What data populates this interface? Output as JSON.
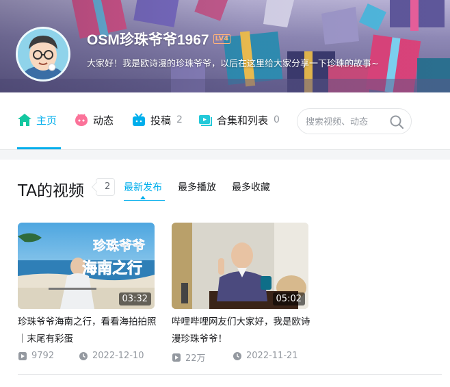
{
  "banner": {
    "username": "OSM珍珠爷爷1967",
    "level": "LV4",
    "signature": "大家好！我是欧诗漫的珍珠爷爷，以后在这里给大家分享一下珍珠的故事~"
  },
  "nav": {
    "items": [
      {
        "label": "主页",
        "count": "",
        "icon": "home-icon",
        "active": true
      },
      {
        "label": "动态",
        "count": "",
        "icon": "dynamic-icon",
        "active": false
      },
      {
        "label": "投稿",
        "count": "2",
        "icon": "tv-icon",
        "active": false
      },
      {
        "label": "合集和列表",
        "count": "0",
        "icon": "playlist-icon",
        "active": false
      }
    ],
    "search_placeholder": "搜索视频、动态"
  },
  "videos_section": {
    "title": "TA的视频",
    "count": "2",
    "tabs": [
      {
        "label": "最新发布",
        "active": true
      },
      {
        "label": "最多播放",
        "active": false
      },
      {
        "label": "最多收藏",
        "active": false
      }
    ],
    "videos": [
      {
        "duration": "03:32",
        "thumb_text_1": "珍珠爷爷",
        "thumb_text_2": "海南之行",
        "title": "珍珠爷爷海南之行，看看海拍拍照｜末尾有彩蛋",
        "plays": "9792",
        "date": "2022-12-10"
      },
      {
        "duration": "05:02",
        "title": "哔哩哔哩网友们大家好，我是欧诗漫珍珠爷爷！",
        "plays": "22万",
        "date": "2022-11-21"
      }
    ]
  },
  "colors": {
    "accent": "#00aeec",
    "text": "#18191c",
    "muted": "#9499a0"
  }
}
